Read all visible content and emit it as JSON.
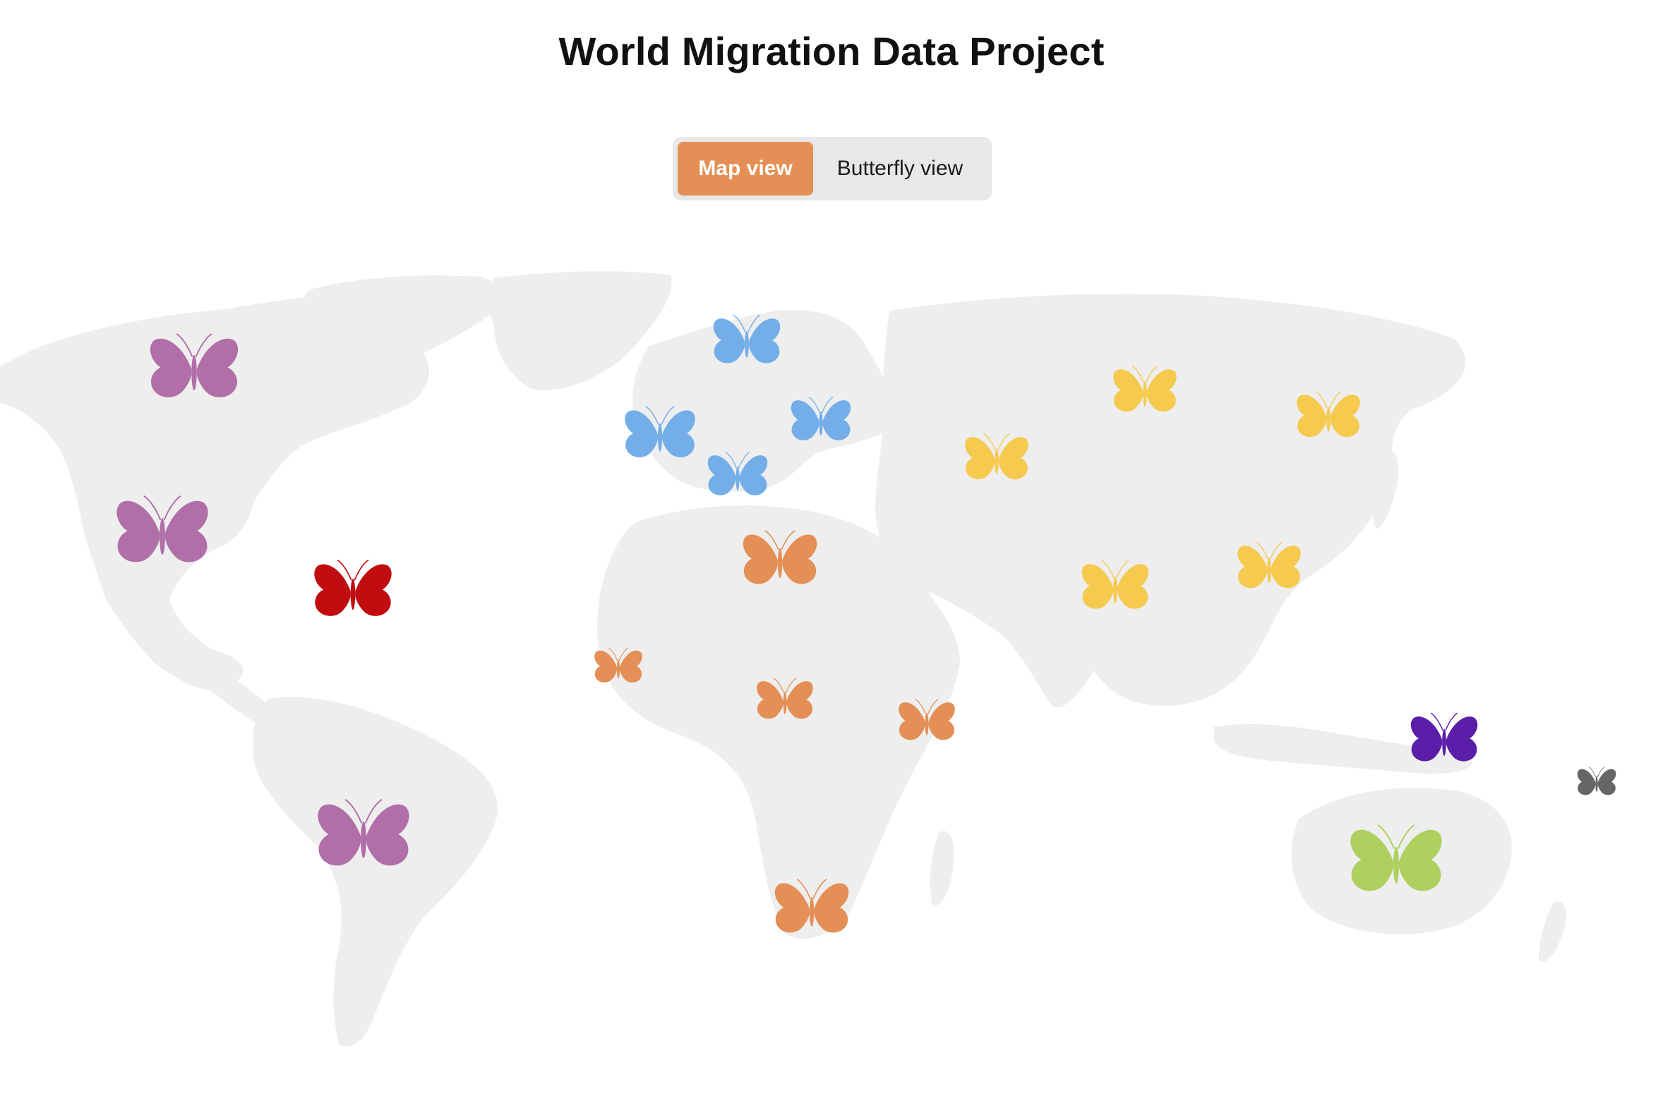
{
  "header": {
    "title": "World Migration Data Project"
  },
  "view_toggle": {
    "options": [
      {
        "label": "Map view",
        "active": true
      },
      {
        "label": "Butterfly view",
        "active": false
      }
    ]
  },
  "map": {
    "land_color": "#eeeeee",
    "markers": [
      {
        "region": "north-america",
        "color": "#b16fa8",
        "icon": "butterfly-icon"
      },
      {
        "region": "north-america",
        "color": "#b16fa8",
        "icon": "butterfly-icon"
      },
      {
        "region": "south-america",
        "color": "#b16fa8",
        "icon": "butterfly-icon"
      },
      {
        "region": "caribbean",
        "color": "#c10d10",
        "icon": "butterfly-icon"
      },
      {
        "region": "europe",
        "color": "#74aee8",
        "icon": "butterfly-icon"
      },
      {
        "region": "europe",
        "color": "#74aee8",
        "icon": "butterfly-icon"
      },
      {
        "region": "europe",
        "color": "#74aee8",
        "icon": "butterfly-icon"
      },
      {
        "region": "europe",
        "color": "#74aee8",
        "icon": "butterfly-icon"
      },
      {
        "region": "africa",
        "color": "#e38f55",
        "icon": "butterfly-icon"
      },
      {
        "region": "africa",
        "color": "#e38f55",
        "icon": "butterfly-icon"
      },
      {
        "region": "africa",
        "color": "#e38f55",
        "icon": "butterfly-icon"
      },
      {
        "region": "africa",
        "color": "#e38f55",
        "icon": "butterfly-icon"
      },
      {
        "region": "africa",
        "color": "#e38f55",
        "icon": "butterfly-icon"
      },
      {
        "region": "asia",
        "color": "#f6c94f",
        "icon": "butterfly-icon"
      },
      {
        "region": "asia",
        "color": "#f6c94f",
        "icon": "butterfly-icon"
      },
      {
        "region": "asia",
        "color": "#f6c94f",
        "icon": "butterfly-icon"
      },
      {
        "region": "asia",
        "color": "#f6c94f",
        "icon": "butterfly-icon"
      },
      {
        "region": "asia",
        "color": "#f6c94f",
        "icon": "butterfly-icon"
      },
      {
        "region": "melanesia",
        "color": "#5a1ea8",
        "icon": "butterfly-icon"
      },
      {
        "region": "pacific",
        "color": "#666666",
        "icon": "butterfly-icon"
      },
      {
        "region": "australia",
        "color": "#aed05f",
        "icon": "butterfly-icon"
      }
    ]
  }
}
